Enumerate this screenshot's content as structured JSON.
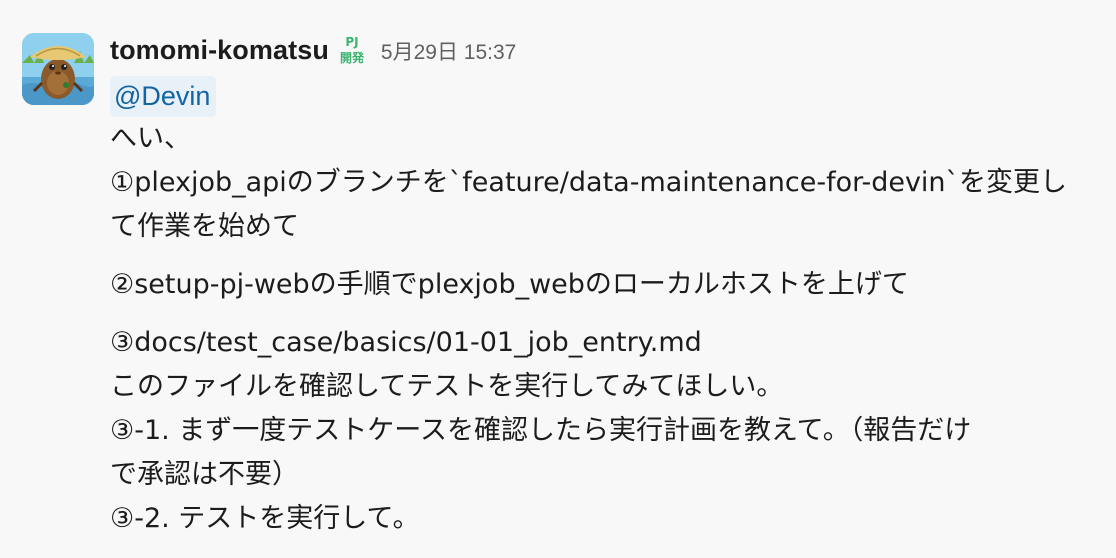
{
  "message": {
    "username": "tomomi-komatsu",
    "badge_icon": "pj-kaihatsu-badge-icon",
    "badge_text_top": "PJ",
    "badge_text_bottom": "開発",
    "timestamp": "5月29日 15:37",
    "mention": "@Devin",
    "lines": {
      "l1": "へい、",
      "l2": "①plexjob_apiのブランチを`feature/data-maintenance-for-devin`を変更し",
      "l3": "て作業を始めて",
      "l4": "②setup-pj-webの手順でplexjob_webのローカルホストを上げて",
      "l5": "③docs/test_case/basics/01-01_job_entry.md",
      "l6": "このファイルを確認してテストを実行してみてほしい。",
      "l7": "③-1. まず一度テストケースを確認したら実行計画を教えて。（報告だけ",
      "l8": "で承認は不要）",
      "l9": "③-2. テストを実行して。"
    }
  },
  "colors": {
    "username": "#1d1c1d",
    "timestamp": "#616061",
    "mention_text": "#1264a3",
    "mention_bg": "#e8f0f8",
    "badge": "#3cb371"
  }
}
